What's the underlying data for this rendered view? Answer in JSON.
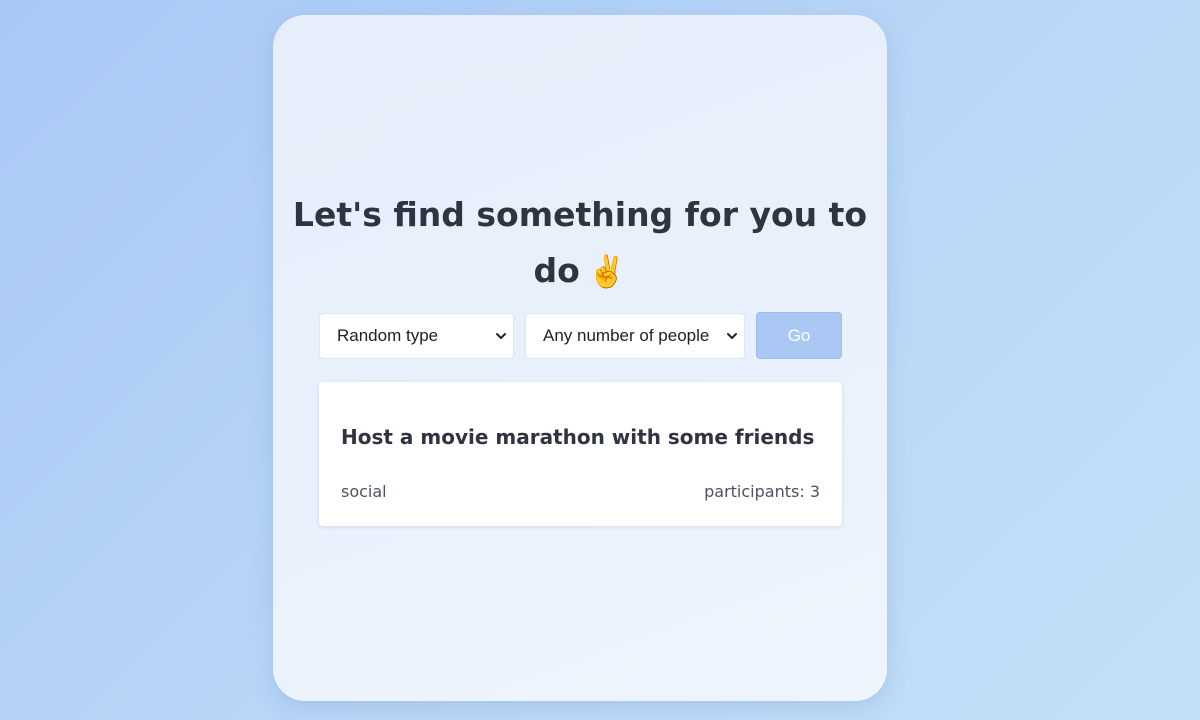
{
  "header": {
    "title_line1": "Let's find something for you to",
    "title_line2": "do",
    "title_emoji": "✌️"
  },
  "filters": {
    "type_select": {
      "selected": "Random type"
    },
    "people_select": {
      "selected": "Any number of people"
    },
    "go_label": "Go"
  },
  "result": {
    "activity": "Host a movie marathon with some friends",
    "type": "social",
    "participants_label": "participants:",
    "participants_value": "3"
  },
  "colors": {
    "background": "#b9d7f7",
    "card": "#e9f1fc",
    "go_button": "#abc8f4",
    "text": "#2f3440"
  },
  "icons": {
    "select_chevron": "chevron-down-icon",
    "emoji": "victory-hand-icon"
  }
}
